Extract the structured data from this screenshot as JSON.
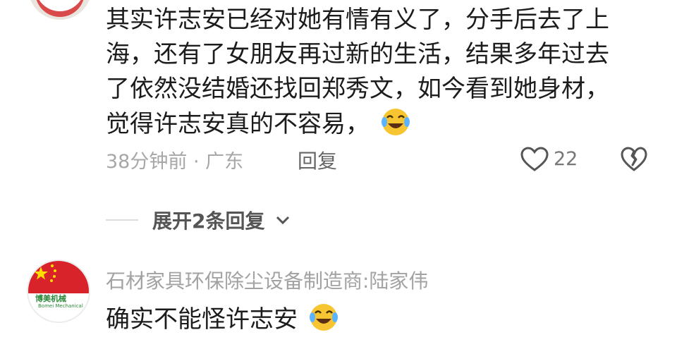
{
  "comment1": {
    "text": "其实许志安已经对她有情有义了，分手后去了上海，还有了女朋友再过新的生活，结果多年过去了依然没结婚还找回郑秀文，如今看到她身材，觉得许志安真的不容易，",
    "meta": "38分钟前 · 广东",
    "reply_label": "回复",
    "like_count": "22",
    "emoji": "laughing-crying-emoji"
  },
  "expand": {
    "label": "展开2条回复"
  },
  "comment2": {
    "username": "石材家具环保除尘设备制造商:陆家伟",
    "text": "确实不能怪许志安",
    "emoji": "laughing-crying-emoji",
    "avatar_logo_text": "博美机械",
    "avatar_logo_sub": "Bomei Mechanical"
  },
  "colors": {
    "text": "#1c1c1c",
    "meta": "#a7a7a7",
    "flag_red": "#d8232a",
    "logo_green": "#2c8a3a"
  }
}
